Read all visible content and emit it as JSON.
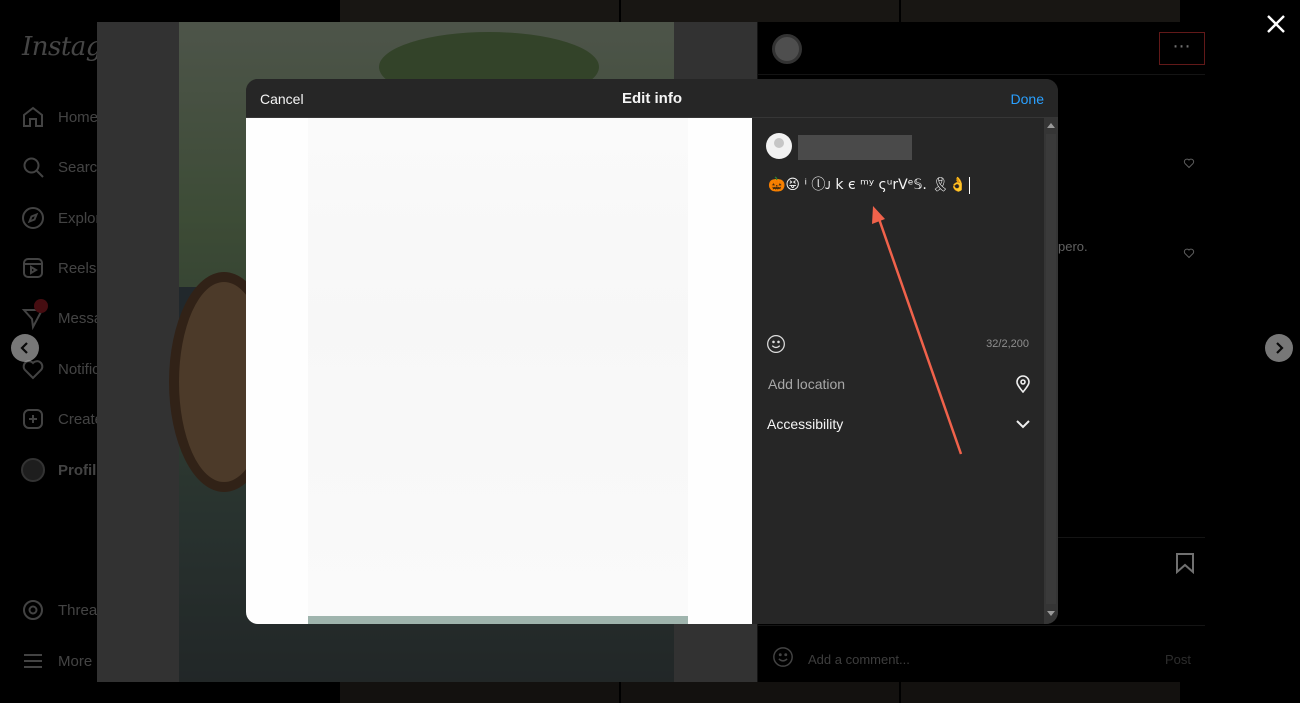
{
  "sidebar": {
    "logo": "Instagram",
    "items": [
      {
        "label": "Home",
        "icon": "home-icon"
      },
      {
        "label": "Search",
        "icon": "search-icon"
      },
      {
        "label": "Explore",
        "icon": "compass-icon"
      },
      {
        "label": "Reels",
        "icon": "reels-icon"
      },
      {
        "label": "Messages",
        "icon": "messenger-icon"
      },
      {
        "label": "Notifications",
        "icon": "heart-icon"
      },
      {
        "label": "Create",
        "icon": "plus-square-icon"
      },
      {
        "label": "Profile",
        "icon": "avatar"
      },
      {
        "label": "Threads",
        "icon": "threads-icon"
      },
      {
        "label": "More",
        "icon": "menu-icon"
      }
    ]
  },
  "post": {
    "more_button": "⋯",
    "comment_fragment": "pero.",
    "add_comment_placeholder": "Add a comment...",
    "post_button": "Post"
  },
  "dialog": {
    "title": "Edit info",
    "cancel": "Cancel",
    "done": "Done",
    "caption": "🎃😝 ⁱ ⓛᴊ k є ᵐʸ ςᵘrVᵉ𝕊. 🎗👌",
    "char_count": "32/2,200",
    "add_location": "Add location",
    "accessibility": "Accessibility"
  },
  "colors": {
    "accent_link": "#2aa0ff",
    "annotation_arrow": "#f0624b",
    "dialog_bg": "#262626",
    "highlight_box": "#e03a3a"
  }
}
